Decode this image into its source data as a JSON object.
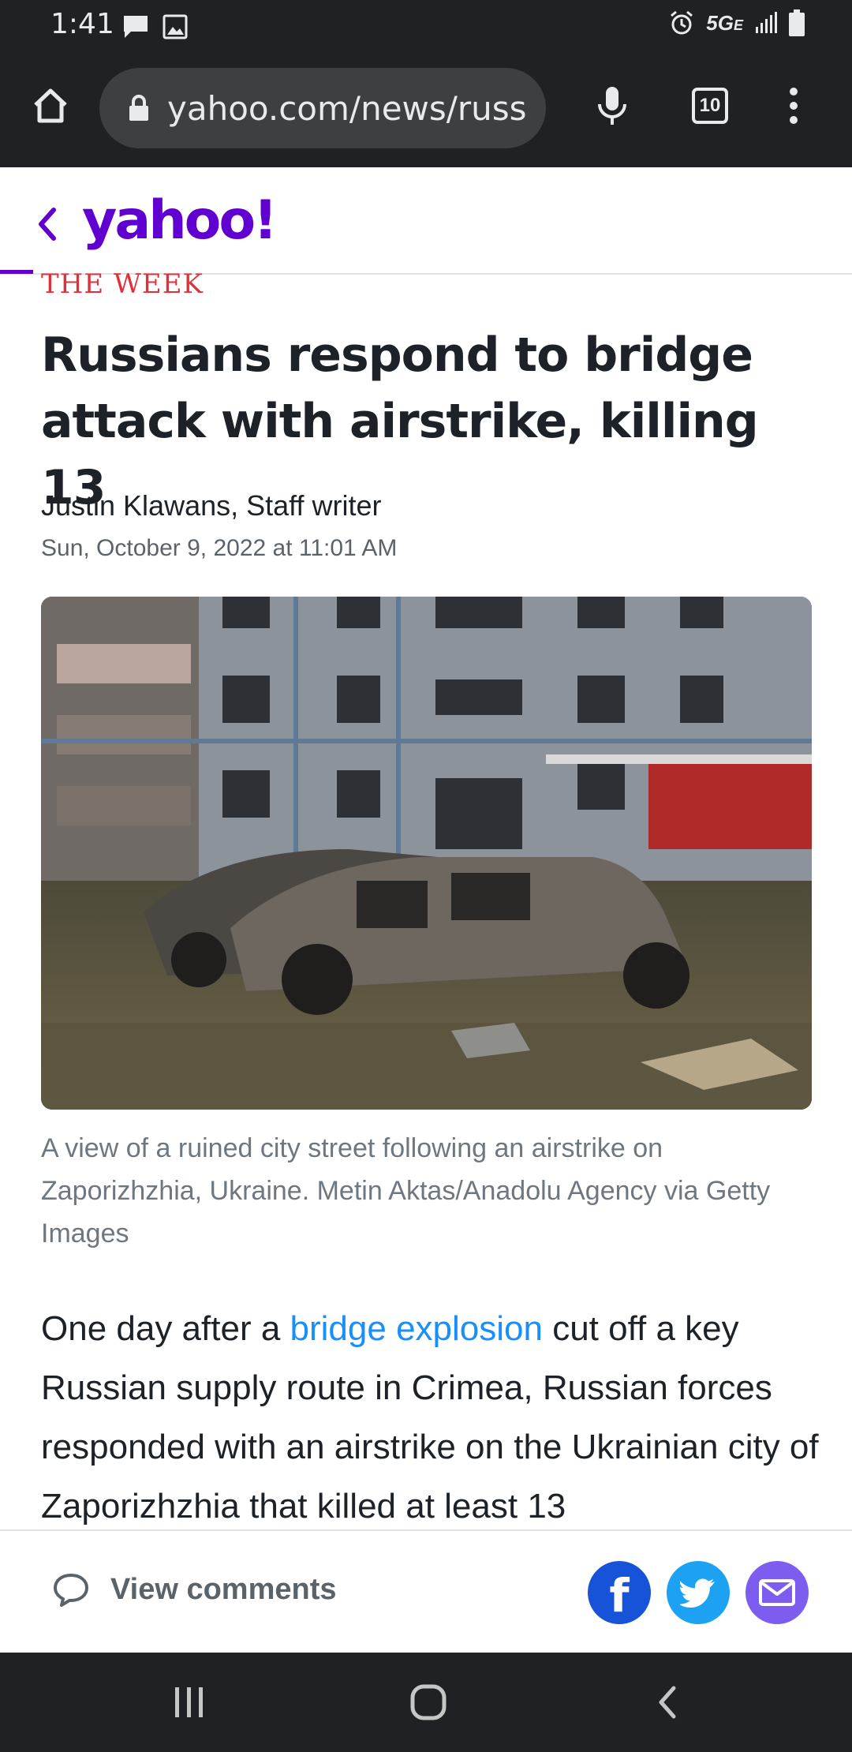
{
  "colors": {
    "system_bar": "#202124",
    "url_pill": "#3c4043",
    "yahoo_purple": "#6001d2",
    "publisher_red": "#e0303a",
    "headline": "#1d2228",
    "meta_gray": "#5b636a",
    "link_blue": "#188fff",
    "facebook": "#1653d8",
    "twitter": "#1da1f2",
    "mail": "#7d5df0"
  },
  "status_bar": {
    "time": "1:41",
    "network": "5G",
    "network_sub": "E",
    "icons": [
      "message-icon",
      "image-icon",
      "alarm-icon",
      "signal-icon",
      "battery-icon"
    ]
  },
  "browser": {
    "url": "yahoo.com/news/russ",
    "tab_count": "10",
    "icons": [
      "home-icon",
      "lock-icon",
      "mic-icon",
      "tabs-icon",
      "more-icon"
    ]
  },
  "header": {
    "logo": "yahoo!",
    "icons": [
      "back-chevron-icon"
    ]
  },
  "article": {
    "publisher": "THE WEEK",
    "headline": "Russians respond to bridge attack with airstrike, killing 13",
    "author": "Justin Klawans, Staff writer",
    "date": "Sun, October 9, 2022 at 11:01 AM",
    "caption": "A view of a ruined city street following an airstrike on Zaporizhzhia, Ukraine. Metin Aktas/Anadolu Agency via Getty Images",
    "body_before_link": "One day after a ",
    "body_link": "bridge explosion",
    "body_after_link": " cut off a key Russian supply route in Crimea, Russian forces responded with an airstrike on the Ukrainian city of Zaporizhzhia that killed at least 13"
  },
  "footer": {
    "comments_label": "View comments",
    "share_icons": [
      "facebook-icon",
      "twitter-icon",
      "mail-icon"
    ]
  },
  "nav": {
    "icons": [
      "recent-apps-icon",
      "home-circle-icon",
      "back-icon"
    ]
  }
}
